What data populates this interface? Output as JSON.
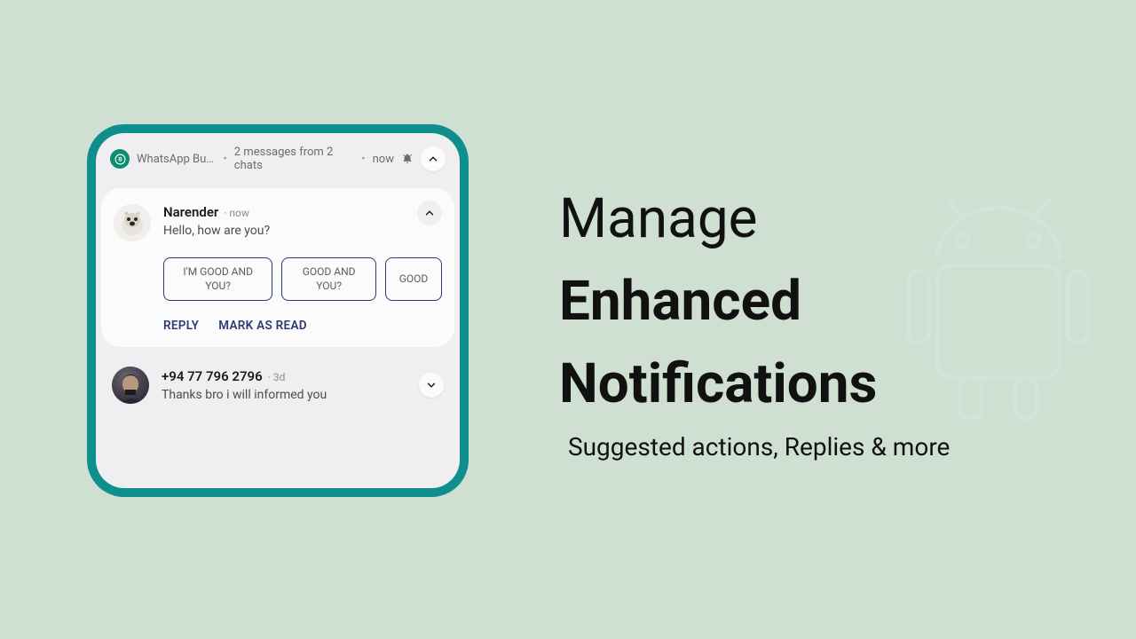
{
  "headline": {
    "line1": "Manage",
    "line2": "Enhanced",
    "line3": "Notifications",
    "subtitle": "Suggested actions, Replies & more"
  },
  "notification": {
    "app_name": "WhatsApp Busi…",
    "summary": "2 messages from 2 chats",
    "time": "now"
  },
  "thread1": {
    "sender": "Narender",
    "time": "now",
    "message": "Hello, how are you?",
    "chips": [
      "I'M GOOD AND YOU?",
      "GOOD AND YOU?",
      "GOOD"
    ],
    "actions": {
      "reply": "REPLY",
      "mark_read": "MARK AS READ"
    }
  },
  "thread2": {
    "sender": "+94 77 796 2796",
    "time": "3d",
    "message": "Thanks bro i will informed you"
  }
}
